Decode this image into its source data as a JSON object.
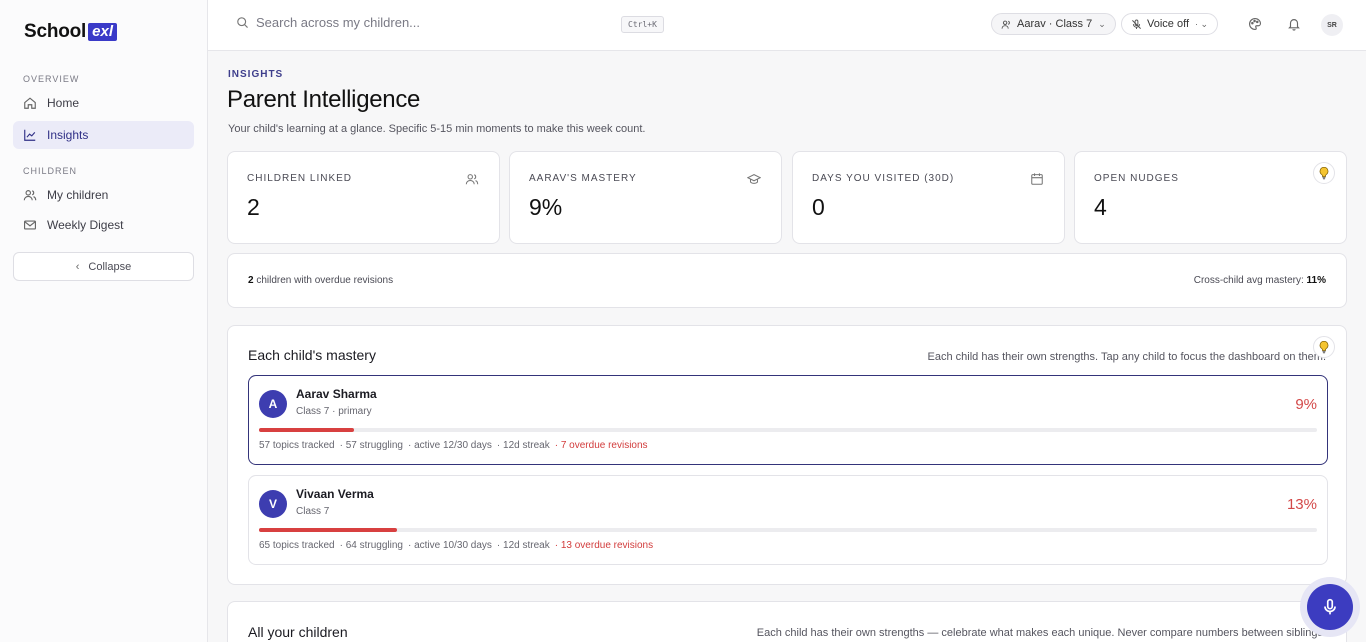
{
  "brand": {
    "name": "School",
    "mark": "exl"
  },
  "sidebar": {
    "sections": [
      {
        "label": "OVERVIEW"
      },
      {
        "label": "CHILDREN"
      }
    ],
    "items": [
      {
        "label": "Home",
        "icon": "home-icon"
      },
      {
        "label": "Insights",
        "icon": "chart-icon",
        "active": true
      },
      {
        "label": "My children",
        "icon": "users-icon"
      },
      {
        "label": "Weekly Digest",
        "icon": "mail-icon"
      }
    ],
    "collapse_label": "Collapse"
  },
  "topbar": {
    "search_placeholder": "Search across my children...",
    "shortcut": "Ctrl+K",
    "child_selector": "Aarav · Class 7",
    "voice": "Voice off",
    "avatar": "SR"
  },
  "header": {
    "eyebrow": "INSIGHTS",
    "title": "Parent Intelligence",
    "subtitle": "Your child's learning at a glance. Specific 5-15 min moments to make this week count."
  },
  "stats": [
    {
      "label": "CHILDREN LINKED",
      "value": "2",
      "icon": "users-icon"
    },
    {
      "label": "AARAV'S MASTERY",
      "value": "9%",
      "icon": "graduation-cap-icon"
    },
    {
      "label": "DAYS YOU VISITED (30D)",
      "value": "0",
      "icon": "calendar-icon"
    },
    {
      "label": "OPEN NUDGES",
      "value": "4",
      "icon": "lightbulb-icon"
    }
  ],
  "summary": {
    "overdue_count": "2",
    "overdue_text": "children with overdue revisions",
    "avg_label": "Cross-child avg mastery:",
    "avg_value": "11%"
  },
  "mastery_panel": {
    "title": "Each child's mastery",
    "note": "Each child has their own strengths. Tap any child to focus the dashboard on them.",
    "children": [
      {
        "initial": "A",
        "name": "Aarav Sharma",
        "class": "Class 7 · primary",
        "percent": "9%",
        "mastery": 0.09,
        "topics": "57 topics tracked",
        "struggling": "· 57 struggling",
        "active": "· active 12/30 days",
        "streak": "· 12d streak",
        "overdue": "· 7 overdue revisions"
      },
      {
        "initial": "V",
        "name": "Vivaan Verma",
        "class": "Class 7",
        "percent": "13%",
        "mastery": 0.13,
        "topics": "65 topics tracked",
        "struggling": "· 64 struggling",
        "active": "· active 10/30 days",
        "streak": "· 12d streak",
        "overdue": "· 13 overdue revisions"
      }
    ]
  },
  "all_panel": {
    "title": "All your children",
    "note": "Each child has their own strengths — celebrate what makes each unique. Never compare numbers between siblings."
  },
  "colors": {
    "accent": "#3d3db0",
    "danger": "#d84040",
    "active_nav_bg": "#ebebf8"
  }
}
